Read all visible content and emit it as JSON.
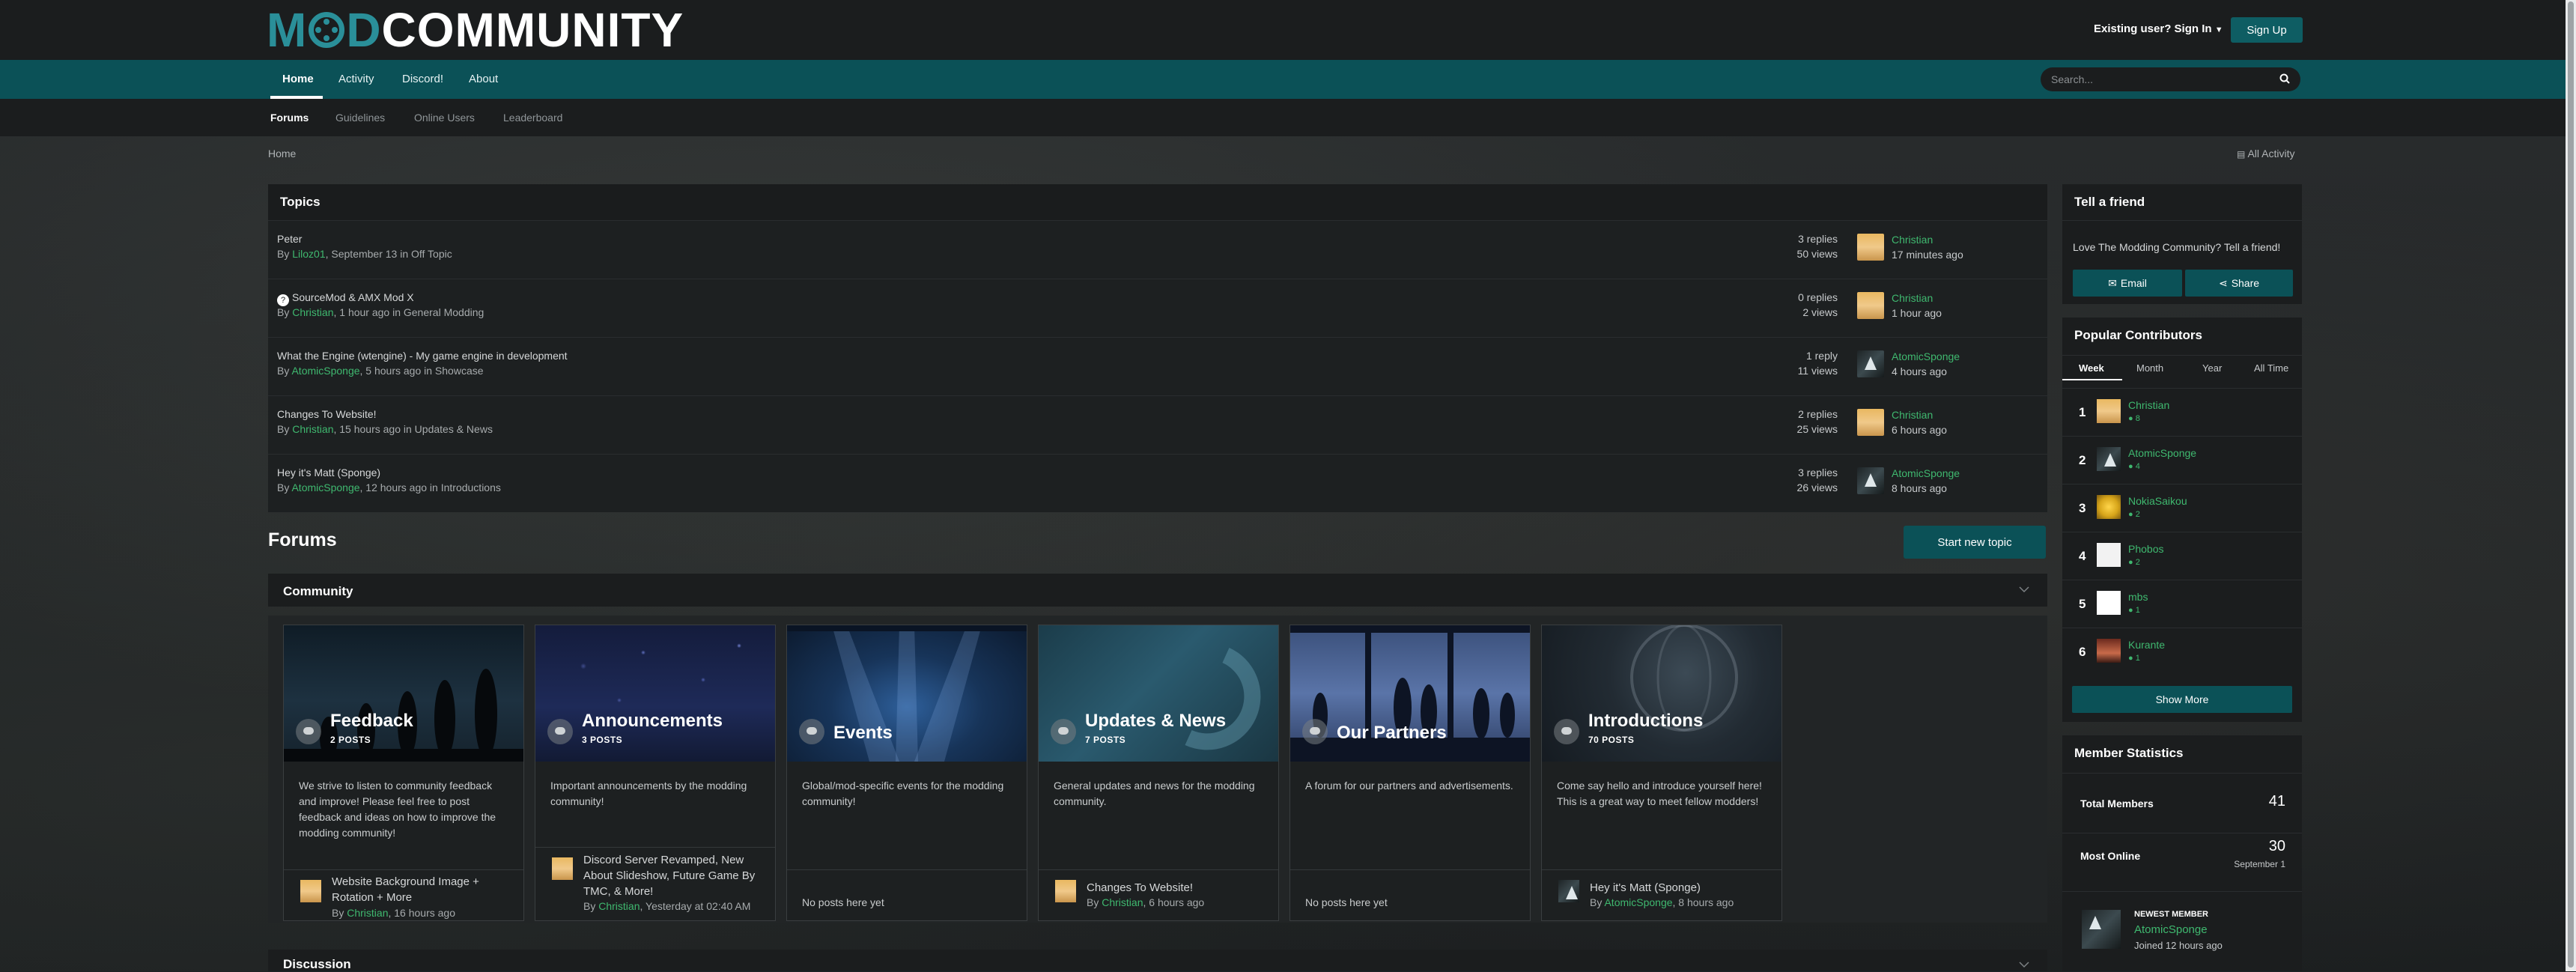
{
  "header": {
    "logo": {
      "mo": "MO",
      "rest": "COMMUNITY"
    },
    "signin": "Existing user? Sign In",
    "signup": "Sign Up"
  },
  "nav": {
    "items": [
      "Home",
      "Activity",
      "Discord!",
      "About"
    ],
    "search_placeholder": "Search..."
  },
  "subnav": {
    "items": [
      "Forums",
      "Guidelines",
      "Online Users",
      "Leaderboard"
    ]
  },
  "breadcrumb": "Home",
  "all_activity": "All Activity",
  "topics": {
    "title": "Topics",
    "rows": [
      {
        "title": "Peter",
        "by": "By ",
        "author": "Liloz01",
        "meta": ", September 13 in Off Topic",
        "replies": "3 replies",
        "views": "50 views",
        "last_user": "Christian",
        "last_time": "17 minutes ago"
      },
      {
        "title": "SourceMod & AMX Mod X",
        "by": "By ",
        "author": "Christian",
        "meta": ", 1 hour ago in General Modding",
        "replies": "0 replies",
        "views": "2 views",
        "last_user": "Christian",
        "last_time": "1 hour ago"
      },
      {
        "title": "What the Engine (wtengine) - My game engine in development",
        "by": "By ",
        "author": "AtomicSponge",
        "meta": ", 5 hours ago in Showcase",
        "replies": "1 reply",
        "views": "11 views",
        "last_user": "AtomicSponge",
        "last_time": "4 hours ago"
      },
      {
        "title": "Changes To Website!",
        "by": "By ",
        "author": "Christian",
        "meta": ", 15 hours ago in Updates & News",
        "replies": "2 replies",
        "views": "25 views",
        "last_user": "Christian",
        "last_time": "6 hours ago"
      },
      {
        "title": "Hey it's Matt (Sponge)",
        "by": "By ",
        "author": "AtomicSponge",
        "meta": ", 12 hours ago in Introductions",
        "replies": "3 replies",
        "views": "26 views",
        "last_user": "AtomicSponge",
        "last_time": "8 hours ago"
      }
    ]
  },
  "forums": {
    "title": "Forums",
    "start_new_topic": "Start new topic",
    "categories": [
      "Community",
      "Discussion"
    ],
    "cards": [
      {
        "name": "Feedback",
        "posts": "2 POSTS",
        "desc": "We strive to listen to community feedback and improve! Please feel free to post feedback and ideas on how to improve the modding community!",
        "last_title": "Website Background Image + Rotation + More",
        "last_by": "By ",
        "last_user": "Christian",
        "last_time": ", 16 hours ago",
        "none": ""
      },
      {
        "name": "Announcements",
        "posts": "3 POSTS",
        "desc": "Important announcements by the modding community!",
        "last_title": "Discord Server Revamped, New About Slideshow, Future Game By TMC, & More!",
        "last_by": "By ",
        "last_user": "Christian",
        "last_time": ", Yesterday at 02:40 AM",
        "none": ""
      },
      {
        "name": "Events",
        "posts": "",
        "desc": "Global/mod-specific events for the modding community!",
        "last_title": "",
        "last_by": "",
        "last_user": "",
        "last_time": "",
        "none": "No posts here yet"
      },
      {
        "name": "Updates & News",
        "posts": "7 POSTS",
        "desc": "General updates and news for the modding community.",
        "last_title": "Changes To Website!",
        "last_by": "By ",
        "last_user": "Christian",
        "last_time": ", 6 hours ago",
        "none": ""
      },
      {
        "name": "Our Partners",
        "posts": "",
        "desc": "A forum for our partners and advertisements.",
        "last_title": "",
        "last_by": "",
        "last_user": "",
        "last_time": "",
        "none": "No posts here yet"
      },
      {
        "name": "Introductions",
        "posts": "70 POSTS",
        "desc": "Come say hello and introduce yourself here! This is a great way to meet fellow modders!",
        "last_title": "Hey it's Matt (Sponge)",
        "last_by": "By ",
        "last_user": "AtomicSponge",
        "last_time": ", 8 hours ago",
        "none": ""
      }
    ]
  },
  "sidebar": {
    "tell": {
      "title": "Tell a friend",
      "text": "Love The Modding Community? Tell a friend!",
      "email": "Email",
      "share": "Share"
    },
    "popular": {
      "title": "Popular Contributors",
      "tabs": [
        "Week",
        "Month",
        "Year",
        "All Time"
      ],
      "rows": [
        {
          "rank": "1",
          "name": "Christian",
          "rep": "8"
        },
        {
          "rank": "2",
          "name": "AtomicSponge",
          "rep": "4"
        },
        {
          "rank": "3",
          "name": "NokiaSaikou",
          "rep": "2"
        },
        {
          "rank": "4",
          "name": "Phobos",
          "rep": "2"
        },
        {
          "rank": "5",
          "name": "mbs",
          "rep": "1"
        },
        {
          "rank": "6",
          "name": "Kurante",
          "rep": "1"
        }
      ],
      "show_more": "Show More"
    },
    "stats": {
      "title": "Member Statistics",
      "total_label": "Total Members",
      "total_value": "41",
      "online_label": "Most Online",
      "online_value": "30",
      "online_date": "September 1",
      "newest_label": "NEWEST MEMBER",
      "newest_name": "AtomicSponge",
      "newest_joined": "Joined 12 hours ago"
    }
  }
}
